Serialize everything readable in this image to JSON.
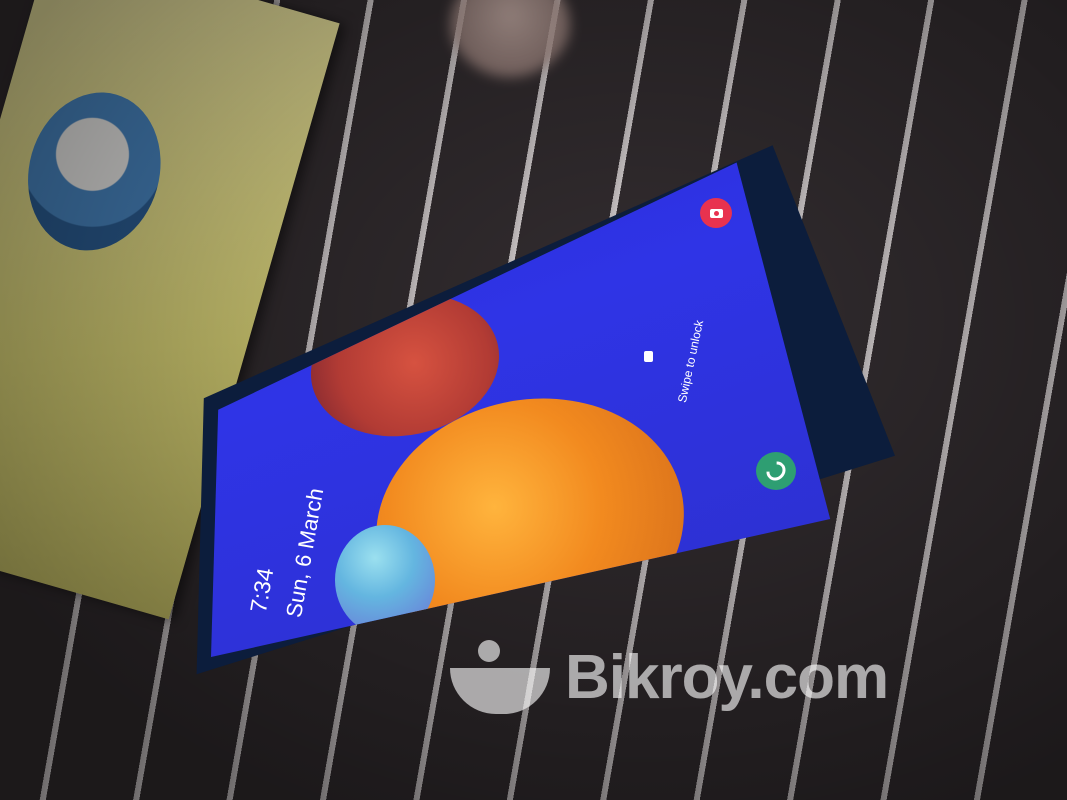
{
  "lockscreen": {
    "time": "7:34",
    "date": "Sun, 6 March",
    "unlock_hint": "Swipe to unlock"
  },
  "shortcuts": {
    "left_icon": "camera-icon",
    "right_icon": "phone-icon"
  },
  "watermark": {
    "text": "Bikroy.com"
  },
  "colors": {
    "wallpaper_blue": "#2f34e6",
    "camera_button": "#e8324f",
    "phone_button": "#2e9e72",
    "magazine": "#e4dd7c"
  }
}
